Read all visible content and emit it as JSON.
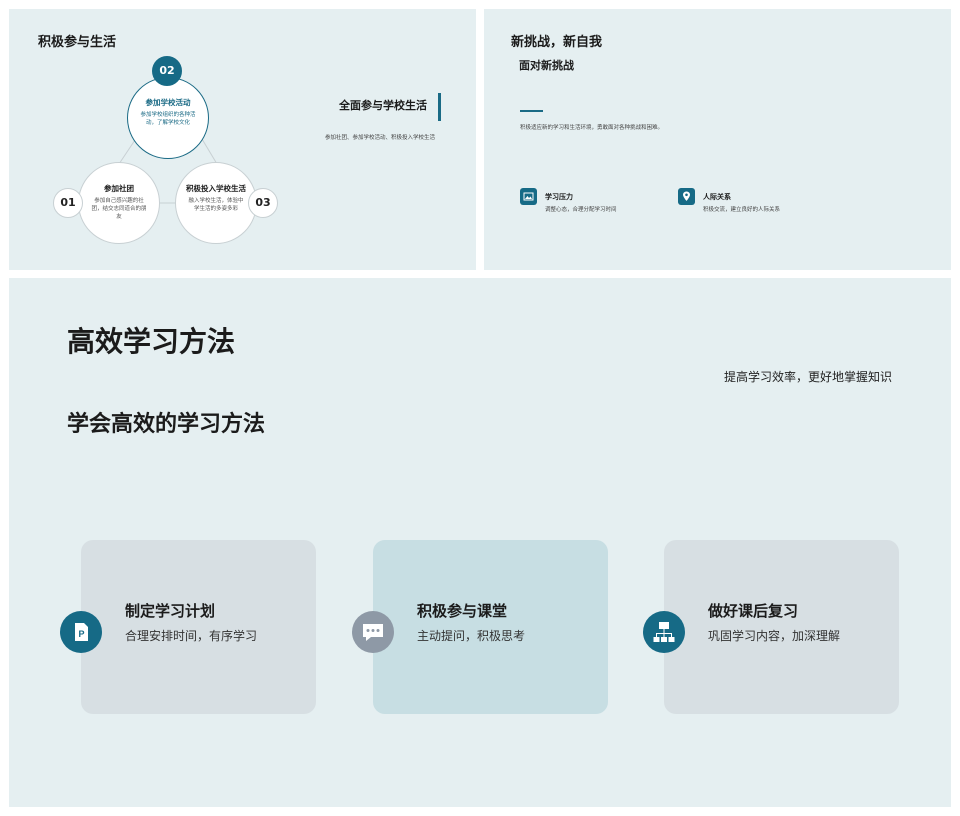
{
  "slide1": {
    "title": "积极参与生活",
    "nodes": [
      {
        "num": "02",
        "title": "参加学校活动",
        "desc": "参加学校组织的各种活动，了解学校文化"
      },
      {
        "num": "01",
        "title": "参加社团",
        "desc": "参加自己感兴趣的社团，结交志同道合的朋友"
      },
      {
        "num": "03",
        "title": "积极投入学校生活",
        "desc": "融入学校生活，体验中学生活的多姿多彩"
      }
    ],
    "right_title": "全面参与学校生活",
    "right_desc": "参加社团、参加学校活动、积极投入学校生活"
  },
  "slide2": {
    "title": "新挑战，新自我",
    "subtitle": "面对新挑战",
    "desc": "积极适应新的学习和生活环境，勇敢面对各种挑战和困难。",
    "items": [
      {
        "icon": "image-icon",
        "title": "学习压力",
        "desc": "调整心态，合理分配学习时间"
      },
      {
        "icon": "location-icon",
        "title": "人际关系",
        "desc": "积极交流，建立良好的人际关系"
      }
    ]
  },
  "slide3": {
    "title": "高效学习方法",
    "right_text": "提高学习效率，更好地掌握知识",
    "subtitle": "学会高效的学习方法",
    "cards": [
      {
        "icon": "document-icon",
        "title": "制定学习计划",
        "desc": "合理安排时间，有序学习"
      },
      {
        "icon": "chat-icon",
        "title": "积极参与课堂",
        "desc": "主动提问，积极思考"
      },
      {
        "icon": "hierarchy-icon",
        "title": "做好课后复习",
        "desc": "巩固学习内容，加深理解"
      }
    ]
  },
  "colors": {
    "accent": "#166a86",
    "background": "#e5eff1",
    "card": "#d7dfe3",
    "card_highlight": "#c7dee3",
    "gray_icon": "#8e99a6"
  }
}
